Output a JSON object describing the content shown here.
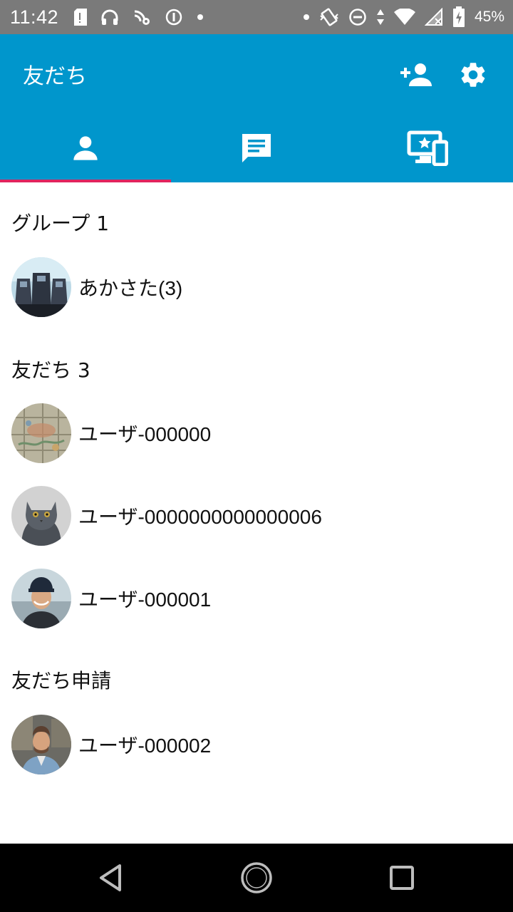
{
  "status_bar": {
    "time": "11:42",
    "battery_percent": "45%",
    "icons_left": [
      "sd-card-icon",
      "headphones-icon",
      "nfc-sync-icon",
      "info-circle-icon",
      "dot-icon"
    ],
    "icons_right": [
      "dot-icon",
      "vibrate-icon",
      "do-not-disturb-icon",
      "data-arrows-icon",
      "wifi-icon",
      "no-signal-icon",
      "battery-charging-icon"
    ]
  },
  "appbar": {
    "title": "友だち",
    "actions": [
      "add-friend-icon",
      "settings-gear-icon"
    ]
  },
  "tabs": [
    {
      "icon": "person-icon",
      "active": true
    },
    {
      "icon": "chat-bubble-icon",
      "active": false
    },
    {
      "icon": "devices-star-icon",
      "active": false
    }
  ],
  "sections": {
    "groups": {
      "header": "グループ 1",
      "items": [
        {
          "label": "あかさた(3)",
          "avatar": "building-photo"
        }
      ]
    },
    "friends": {
      "header": "友だち 3",
      "items": [
        {
          "label": "ユーザ-000000",
          "avatar": "map-photo"
        },
        {
          "label": "ユーザ-0000000000000006",
          "avatar": "cat-photo"
        },
        {
          "label": "ユーザ-000001",
          "avatar": "man-cap-photo"
        }
      ]
    },
    "requests": {
      "header": "友だち申請",
      "items": [
        {
          "label": "ユーザ-000002",
          "avatar": "man-denim-photo"
        }
      ]
    }
  },
  "colors": {
    "appbar": "#0096cc",
    "tab_indicator": "#e0245e",
    "status_bar": "#7a7a7a"
  }
}
